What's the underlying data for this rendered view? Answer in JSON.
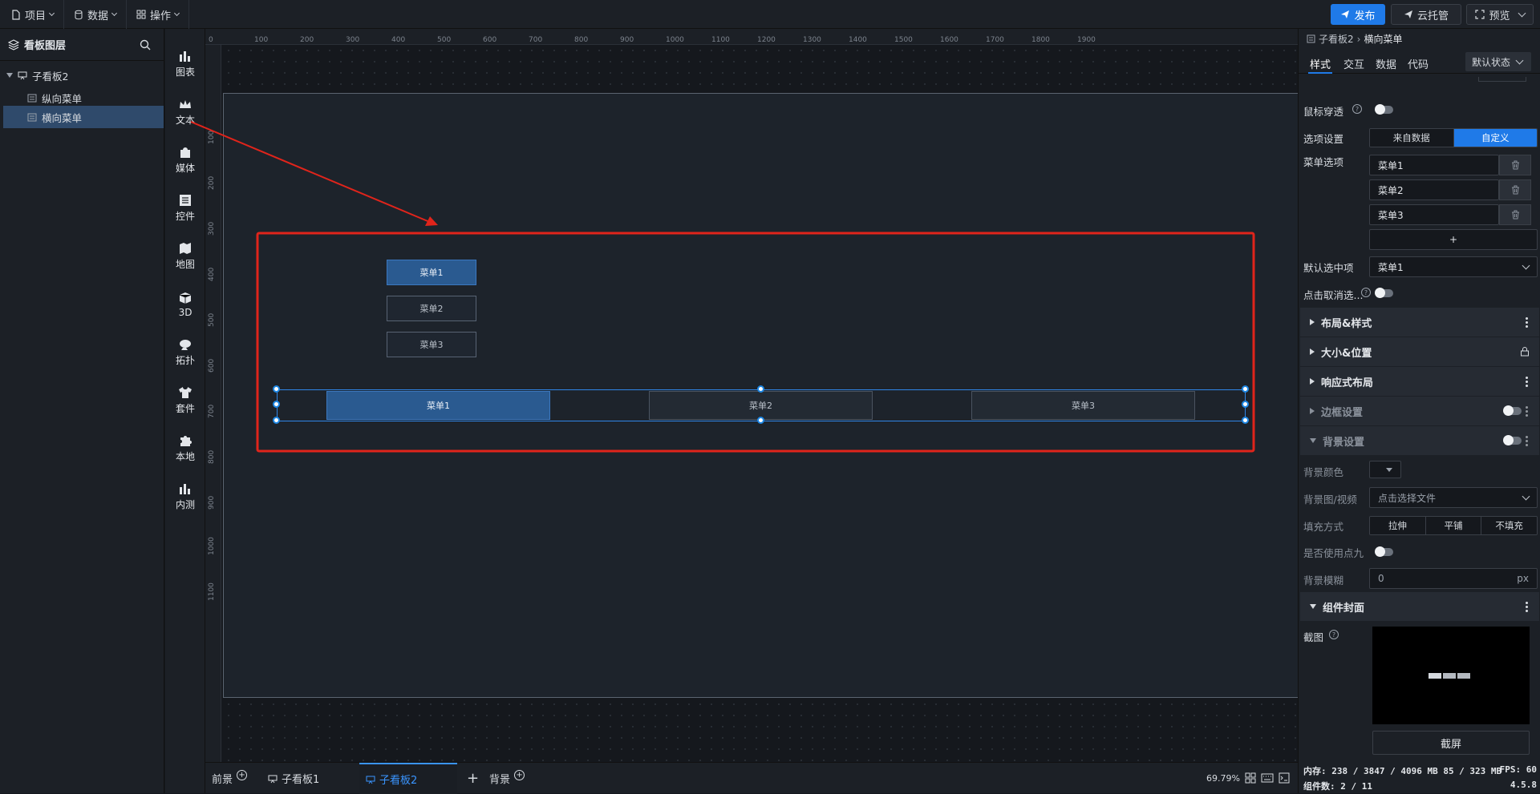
{
  "topbar": {
    "menus": [
      "项目",
      "数据",
      "操作"
    ],
    "publish": "发布",
    "cloud": "云托管",
    "preview": "预览"
  },
  "layers": {
    "title": "看板图层",
    "root": "子看板2",
    "items": [
      "纵向菜单",
      "横向菜单"
    ]
  },
  "tools": [
    "图表",
    "文本",
    "媒体",
    "控件",
    "地图",
    "3D",
    "拓扑",
    "套件",
    "本地",
    "内测"
  ],
  "ruler": {
    "h": [
      "0",
      "100",
      "200",
      "300",
      "400",
      "500",
      "600",
      "700",
      "800",
      "900",
      "1000",
      "1100",
      "1200",
      "1300",
      "1400",
      "1500",
      "1600",
      "1700",
      "1800",
      "1900"
    ],
    "v": [
      "100",
      "200",
      "300",
      "400",
      "500",
      "600",
      "700",
      "800",
      "900",
      "1000",
      "1100"
    ]
  },
  "canvas": {
    "vertical_menu": [
      "菜单1",
      "菜单2",
      "菜单3"
    ],
    "horizontal_menu": [
      "菜单1",
      "菜单2",
      "菜单3"
    ]
  },
  "bottom": {
    "tabs": [
      "前景",
      "子看板1",
      "子看板2",
      "背景"
    ],
    "zoom": "69.79%"
  },
  "props": {
    "breadcrumb_parent": "子看板2",
    "breadcrumb_current": "横向菜单",
    "tabs": [
      "样式",
      "交互",
      "数据",
      "代码"
    ],
    "state": "默认状态",
    "mouse_through": "鼠标穿透",
    "option_setting": "选项设置",
    "option_from_data": "来自数据",
    "option_custom": "自定义",
    "menu_options": "菜单选项",
    "menu_items": [
      "菜单1",
      "菜单2",
      "菜单3"
    ],
    "add": "+",
    "default_selected_label": "默认选中项",
    "default_selected_value": "菜单1",
    "click_cancel": "点击取消选...",
    "sections": {
      "layout": "布局&样式",
      "size": "大小&位置",
      "responsive": "响应式布局",
      "border": "边框设置",
      "background": "背景设置"
    },
    "bg_color": "背景颜色",
    "bg_image": "背景图/视频",
    "bg_image_value": "点击选择文件",
    "fill_mode": "填充方式",
    "fill_options": [
      "拉伸",
      "平铺",
      "不填充"
    ],
    "nine_patch": "是否使用点九",
    "bg_blur": "背景模糊",
    "bg_blur_value": "0",
    "bg_blur_unit": "px",
    "cover_section": "组件封面",
    "screenshot_label": "截图",
    "capture_button": "截屏",
    "memory": "内存: 238 / 3847 / 4096 MB  85 / 323 MB",
    "fps": "FPS: 60",
    "components": "组件数: 2 / 11",
    "version": "4.5.8"
  },
  "colors": {
    "accent": "#1f7ae8",
    "annotation": "#e0241b"
  }
}
